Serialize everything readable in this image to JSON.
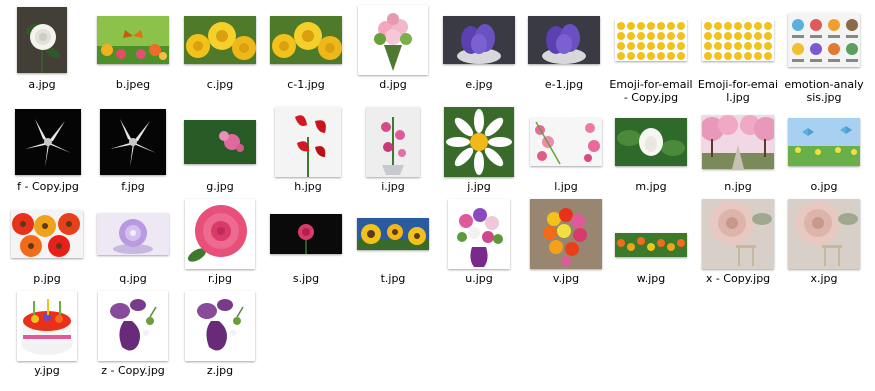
{
  "files": [
    {
      "name": "a.jpg"
    },
    {
      "name": "b.jpeg"
    },
    {
      "name": "c.jpg"
    },
    {
      "name": "c-1.jpg"
    },
    {
      "name": "d.jpg"
    },
    {
      "name": "e.jpg"
    },
    {
      "name": "e-1.jpg"
    },
    {
      "name": "Emoji-for-email - Copy.jpg"
    },
    {
      "name": "Emoji-for-email.jpg"
    },
    {
      "name": "emotion-analysis.jpg"
    },
    {
      "name": "f - Copy.jpg"
    },
    {
      "name": "f.jpg"
    },
    {
      "name": "g.jpg"
    },
    {
      "name": "h.jpg"
    },
    {
      "name": "i.jpg"
    },
    {
      "name": "j.jpg"
    },
    {
      "name": "l.jpg"
    },
    {
      "name": "m.jpg"
    },
    {
      "name": "n.jpg"
    },
    {
      "name": "o.jpg"
    },
    {
      "name": "p.jpg"
    },
    {
      "name": "q.jpg"
    },
    {
      "name": "r.jpg"
    },
    {
      "name": "s.jpg"
    },
    {
      "name": "t.jpg"
    },
    {
      "name": "u.jpg"
    },
    {
      "name": "v.jpg"
    },
    {
      "name": "w.jpg"
    },
    {
      "name": "x - Copy.jpg"
    },
    {
      "name": "x.jpg"
    },
    {
      "name": "y.jpg"
    },
    {
      "name": "z - Copy.jpg"
    },
    {
      "name": "z.jpg"
    }
  ]
}
